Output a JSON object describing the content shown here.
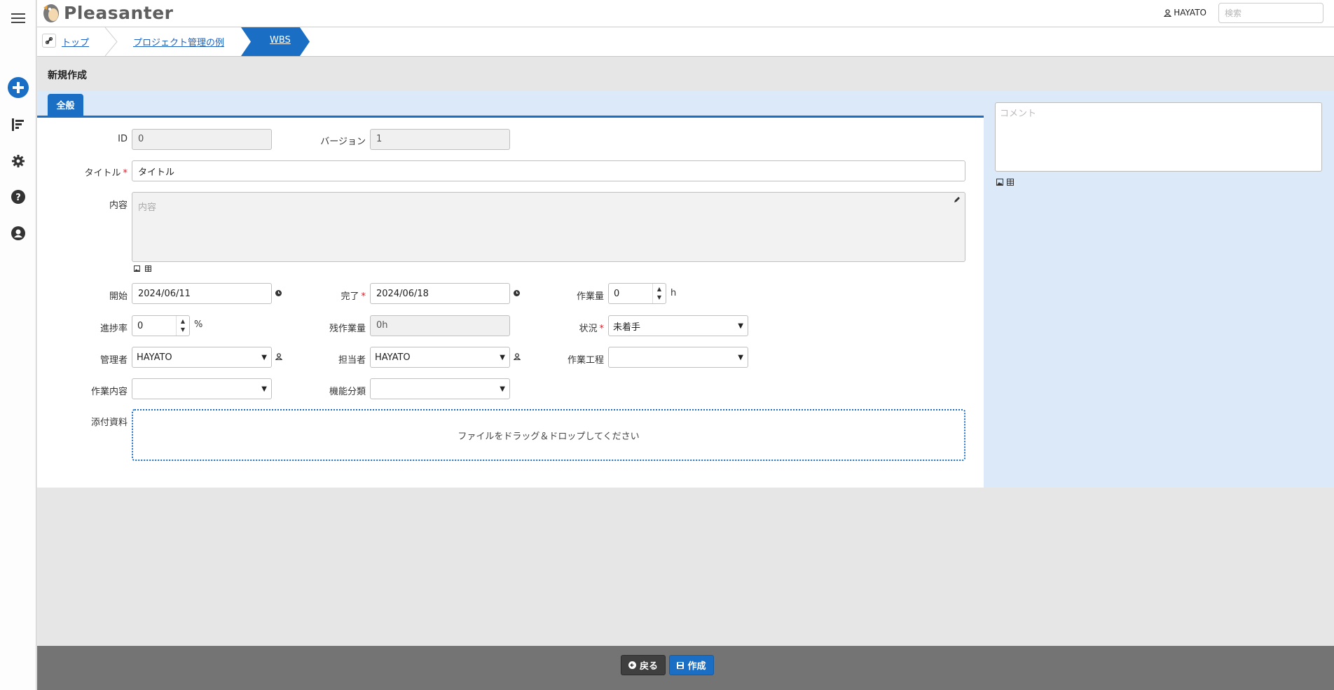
{
  "header": {
    "app_name": "Pleasanter",
    "user_name": "HAYATO",
    "search_placeholder": "検索"
  },
  "breadcrumb": {
    "items": [
      "トップ",
      "プロジェクト管理の例"
    ],
    "current": "WBS"
  },
  "page": {
    "title": "新規作成",
    "tab_general": "全般"
  },
  "form": {
    "id_label": "ID",
    "id_value": "0",
    "version_label": "バージョン",
    "version_value": "1",
    "title_label": "タイトル",
    "title_value": "タイトル",
    "required_mark": "*",
    "content_label": "内容",
    "content_placeholder": "内容",
    "start_label": "開始",
    "start_value": "2024/06/11",
    "end_label": "完了",
    "end_value": "2024/06/18",
    "workload_label": "作業量",
    "workload_value": "0",
    "workload_unit": "h",
    "progress_label": "進捗率",
    "progress_value": "0",
    "progress_unit": "%",
    "remaining_label": "残作業量",
    "remaining_value": "0h",
    "status_label": "状況",
    "status_value": "未着手",
    "manager_label": "管理者",
    "manager_value": "HAYATO",
    "owner_label": "担当者",
    "owner_value": "HAYATO",
    "process_label": "作業工程",
    "process_value": "",
    "work_content_label": "作業内容",
    "work_content_value": "",
    "function_label": "機能分類",
    "function_value": "",
    "attachments_label": "添付資料",
    "dropzone_text": "ファイルをドラッグ＆ドロップしてください"
  },
  "comment": {
    "placeholder": "コメント"
  },
  "footer": {
    "back_label": "戻る",
    "create_label": "作成"
  }
}
